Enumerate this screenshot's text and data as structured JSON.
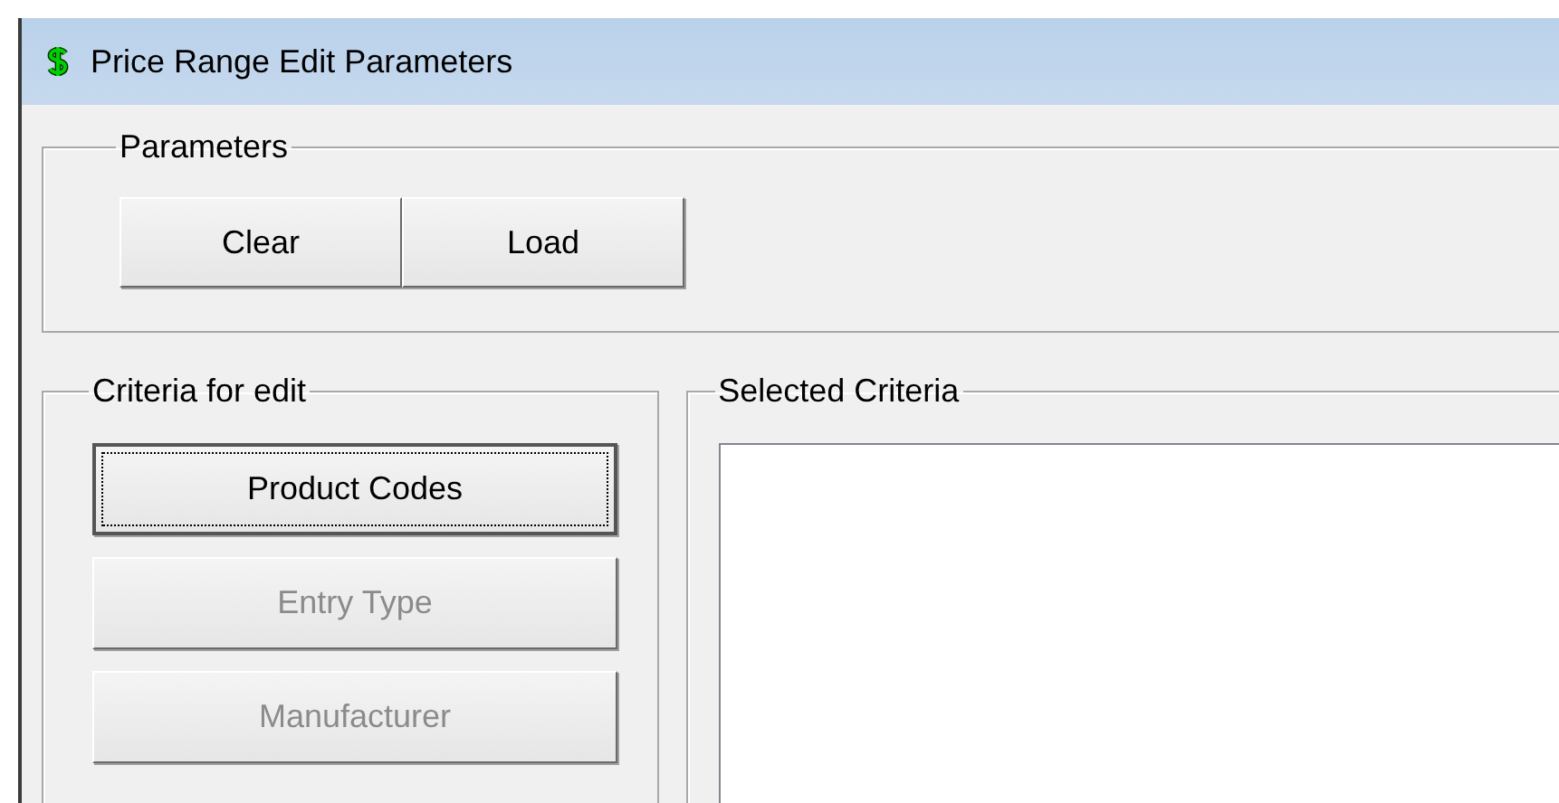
{
  "window": {
    "title": "Price Range Edit Parameters"
  },
  "parameters": {
    "label": "Parameters",
    "buttons": [
      {
        "label": "Clear"
      },
      {
        "label": "Load"
      }
    ]
  },
  "criteria": {
    "label": "Criteria for edit",
    "buttons": [
      {
        "label": "Product Codes",
        "focused": true,
        "disabled": false
      },
      {
        "label": "Entry Type",
        "focused": false,
        "disabled": true
      },
      {
        "label": "Manufacturer",
        "focused": false,
        "disabled": true
      }
    ]
  },
  "selected_criteria": {
    "label": "Selected Criteria"
  }
}
